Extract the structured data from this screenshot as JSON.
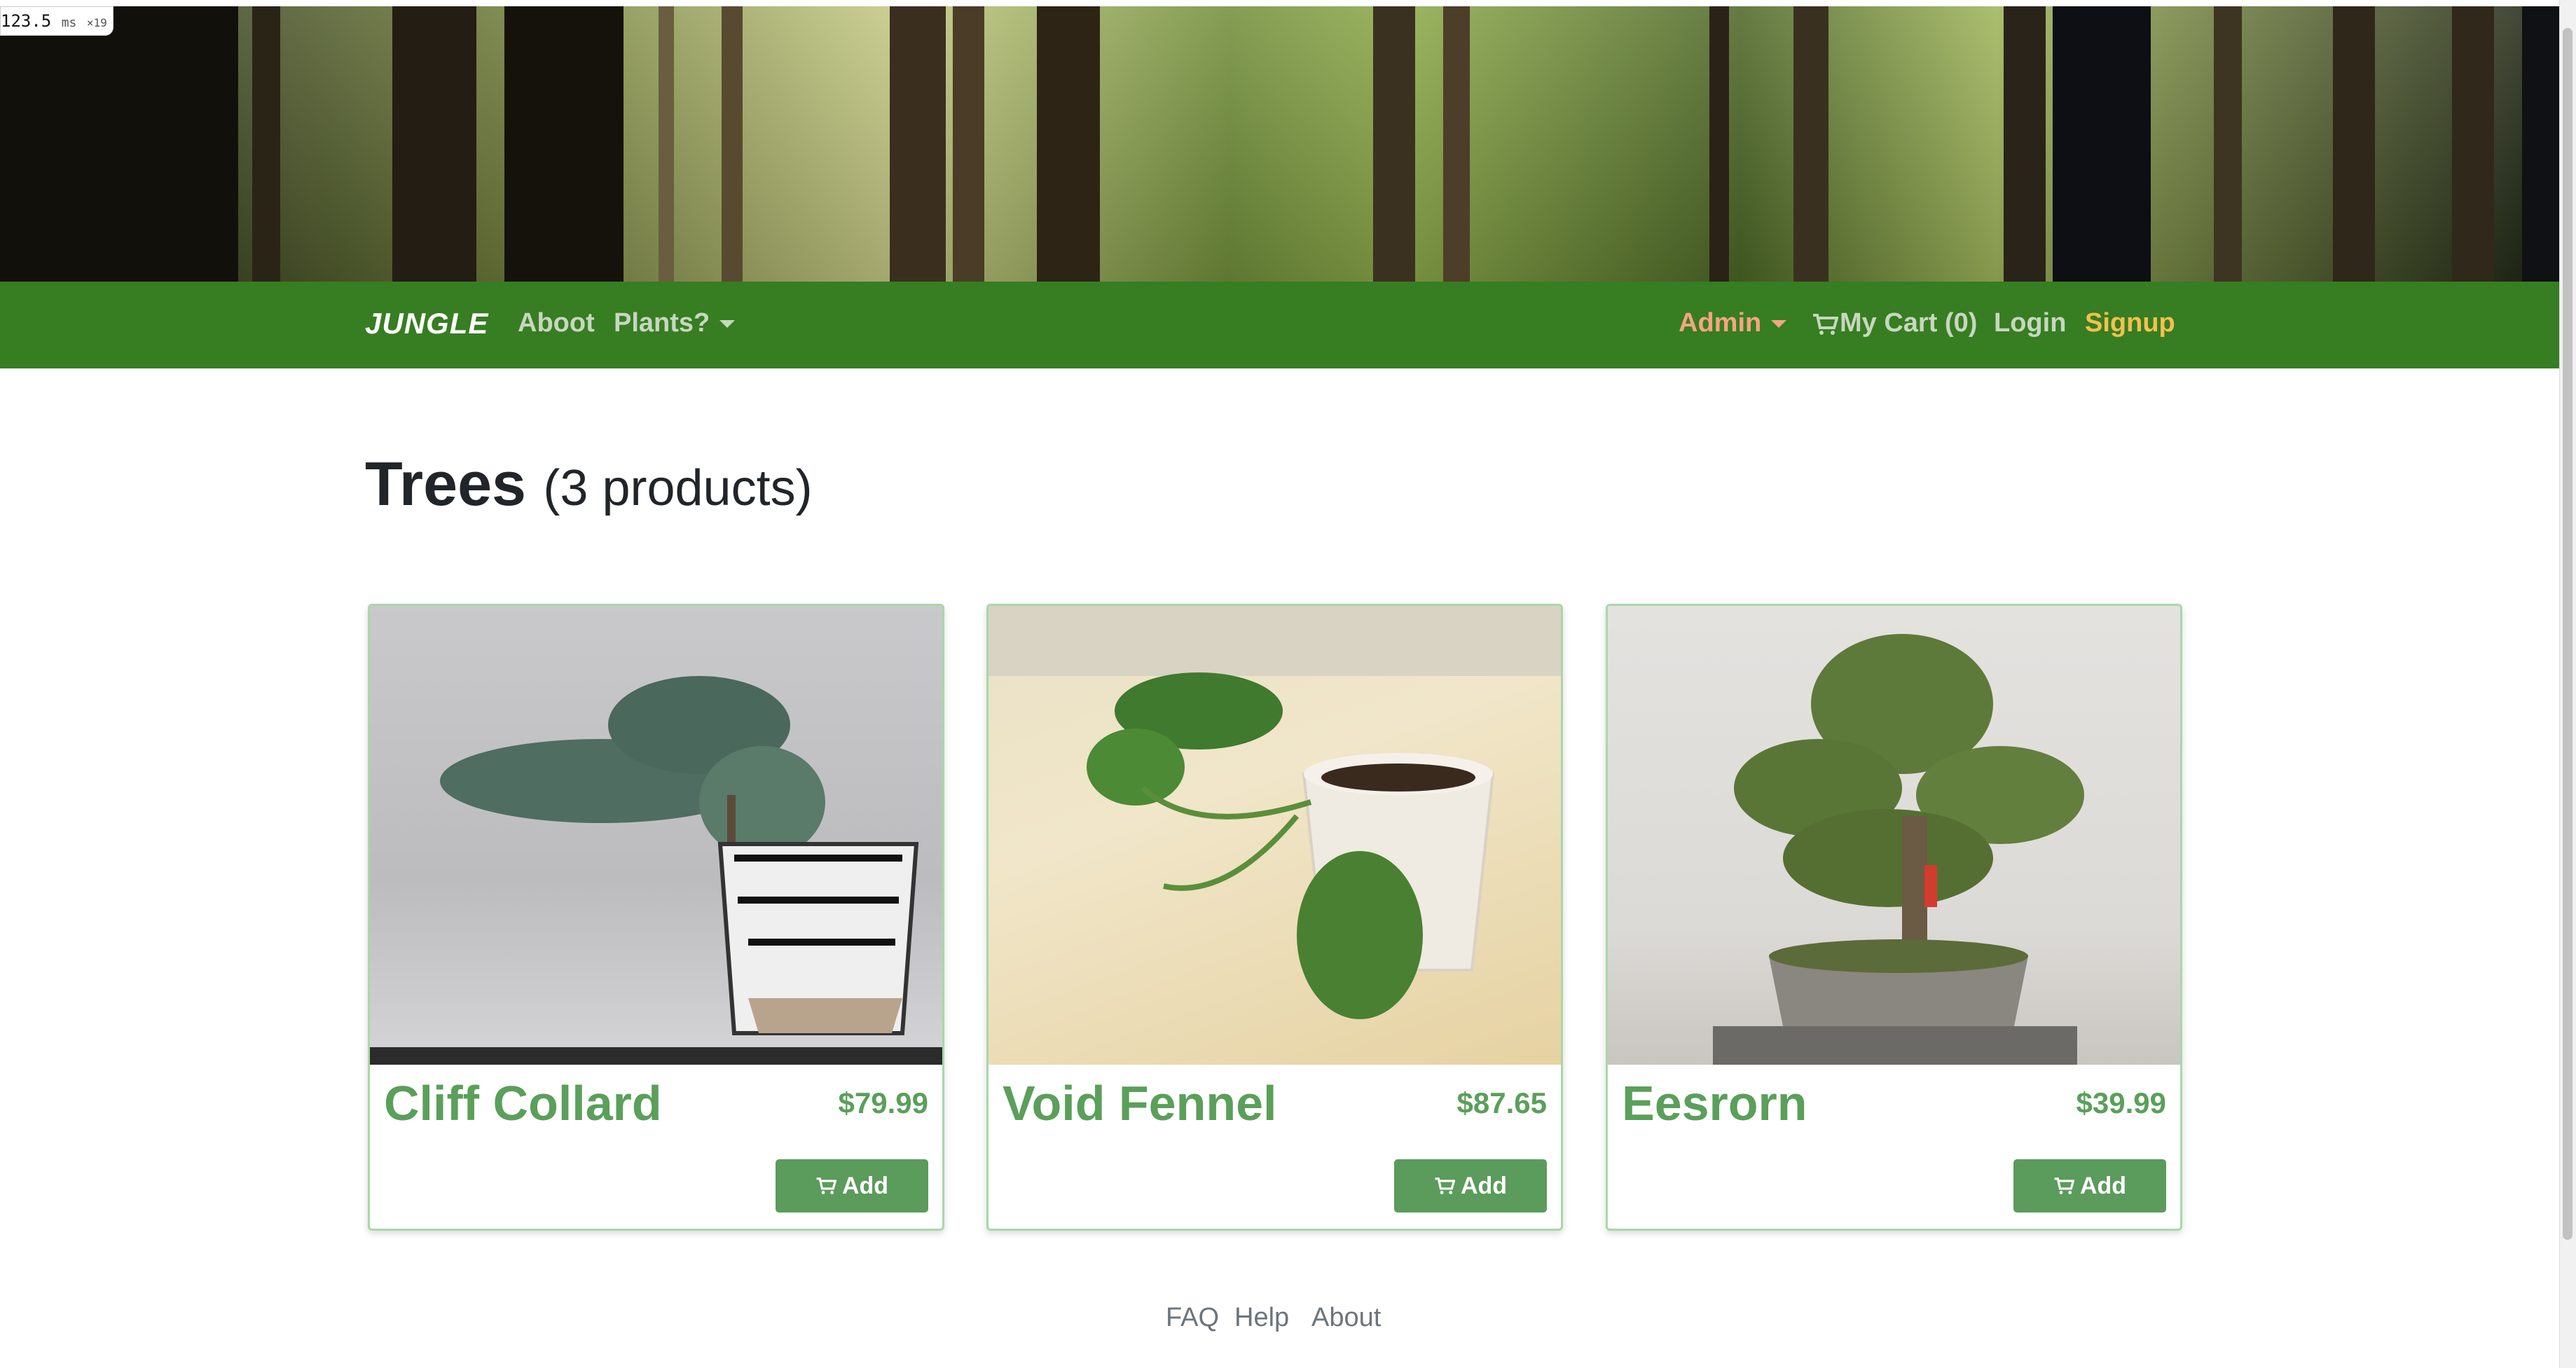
{
  "perf": {
    "value": "123.5",
    "unit": "ms",
    "multiplier": "×19"
  },
  "nav": {
    "brand": "JUNGLE",
    "about": "Aboot",
    "plants": "Plants?",
    "admin": "Admin",
    "cart": "My Cart (0)",
    "login": "Login",
    "signup": "Signup",
    "colors": {
      "navbar": "#377d22",
      "admin": "#f4a582",
      "signup": "#f2c14e",
      "link": "#c7d7c0"
    }
  },
  "page": {
    "title": "Trees",
    "count": "(3 products)"
  },
  "products": [
    {
      "name": "Cliff Collard",
      "price": "$79.99",
      "add_label": "Add"
    },
    {
      "name": "Void Fennel",
      "price": "$87.65",
      "add_label": "Add"
    },
    {
      "name": "Eesrorn",
      "price": "$39.99",
      "add_label": "Add"
    }
  ],
  "footer": {
    "faq": "FAQ",
    "help": "Help",
    "about": "About"
  },
  "icons": {
    "cart": "shopping-cart-icon",
    "caret": "caret-down-icon"
  }
}
